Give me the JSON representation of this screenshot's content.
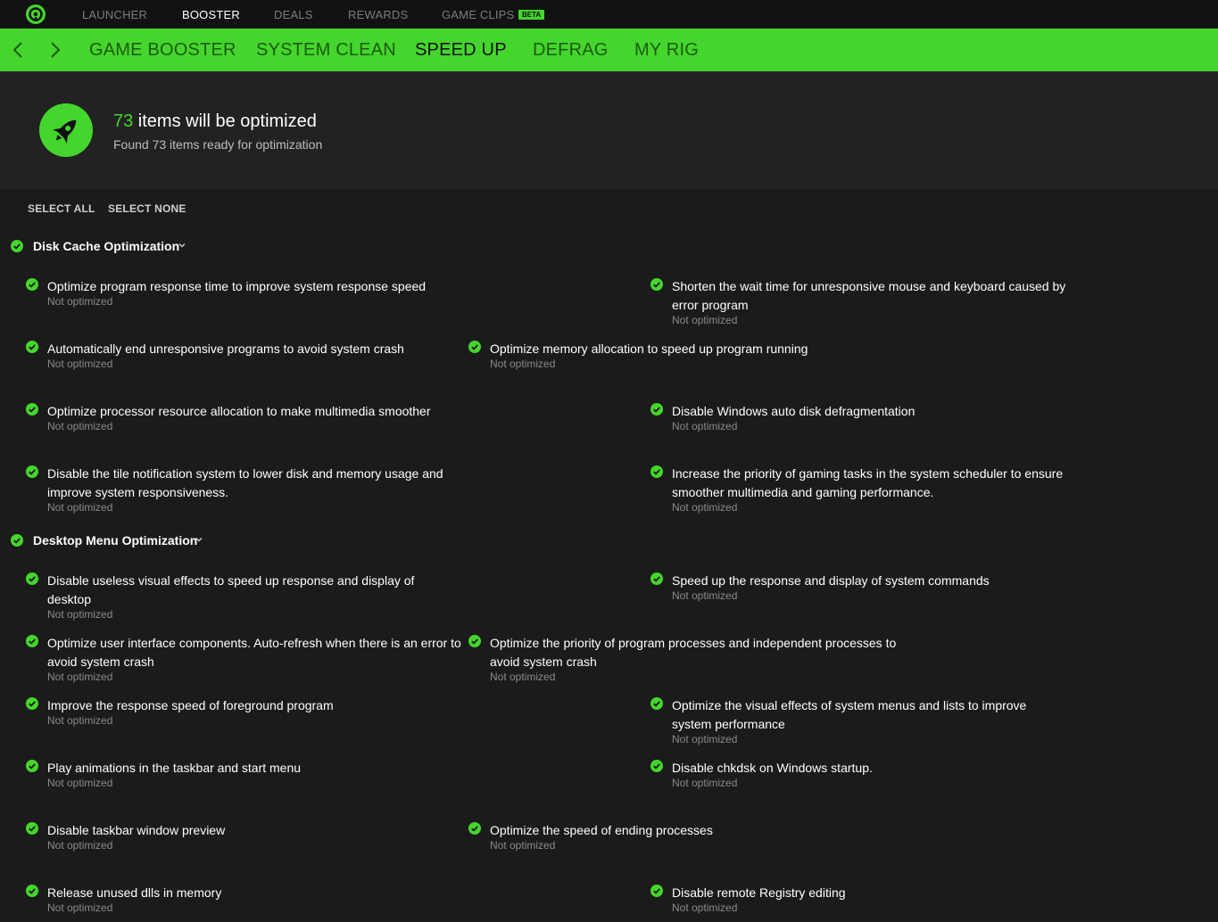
{
  "topnav": {
    "items": [
      "LAUNCHER",
      "BOOSTER",
      "DEALS",
      "REWARDS",
      "GAME CLIPS"
    ],
    "active": "BOOSTER",
    "beta_badge": "BETA"
  },
  "subnav": {
    "items": [
      "GAME BOOSTER",
      "SYSTEM CLEAN",
      "SPEED UP",
      "DEFRAG",
      "MY RIG"
    ],
    "active": "SPEED UP"
  },
  "header": {
    "count": "73",
    "title_suffix": " items will be optimized",
    "subtitle": "Found 73 items ready for optimization"
  },
  "actions": {
    "select_all": "SELECT ALL",
    "select_none": "SELECT NONE"
  },
  "sections": [
    {
      "title": "Disk Cache Optimization",
      "items": [
        {
          "label": "Optimize program response time to improve system response speed",
          "status": "Not optimized"
        },
        {
          "label": "Shorten the wait time for unresponsive mouse and keyboard caused by error program",
          "status": "Not optimized"
        },
        {
          "label": "Automatically end unresponsive programs to avoid system crash",
          "status": "Not optimized"
        },
        {
          "label": "Optimize memory allocation to speed up program running",
          "status": "Not optimized"
        },
        {
          "label": "Optimize processor resource allocation to make multimedia smoother",
          "status": "Not optimized"
        },
        {
          "label": "Disable Windows auto disk defragmentation",
          "status": "Not optimized"
        },
        {
          "label": "Disable the tile notification system to lower disk and memory usage and improve system responsiveness.",
          "status": "Not optimized"
        },
        {
          "label": "Increase the priority of gaming tasks in the system scheduler to ensure smoother multimedia and gaming performance.",
          "status": "Not optimized"
        }
      ]
    },
    {
      "title": "Desktop Menu Optimization",
      "items": [
        {
          "label": "Disable useless visual effects to speed up response and display of desktop",
          "status": "Not optimized"
        },
        {
          "label": "Speed up the response and display of system commands",
          "status": "Not optimized"
        },
        {
          "label": "Optimize user interface components. Auto-refresh when there is an error to avoid system crash",
          "status": "Not optimized"
        },
        {
          "label": "Optimize the priority of program processes and independent processes to avoid system crash",
          "status": "Not optimized"
        },
        {
          "label": "Improve the response speed of foreground program",
          "status": "Not optimized"
        },
        {
          "label": "Optimize the visual effects of system menus and lists to improve system performance",
          "status": "Not optimized"
        },
        {
          "label": "Play animations in the taskbar and start menu",
          "status": "Not optimized"
        },
        {
          "label": "Disable chkdsk on Windows startup.",
          "status": "Not optimized"
        },
        {
          "label": "Disable taskbar window preview",
          "status": "Not optimized"
        },
        {
          "label": "Optimize the speed of ending processes",
          "status": "Not optimized"
        },
        {
          "label": "Release unused dlls in memory",
          "status": "Not optimized"
        },
        {
          "label": "Disable remote Registry editing",
          "status": "Not optimized"
        }
      ]
    }
  ],
  "colors": {
    "accent": "#44d62c",
    "background": "#1b1b1b",
    "header_panel": "#222222",
    "topbar": "#121212"
  }
}
